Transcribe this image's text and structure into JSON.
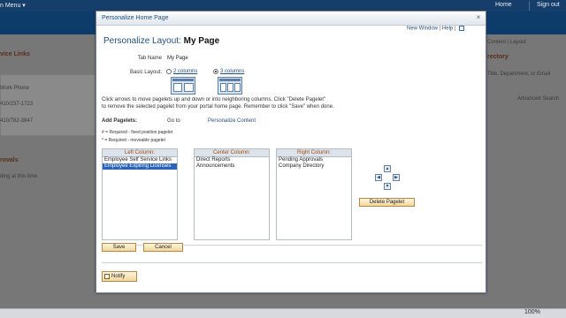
{
  "bg": {
    "menu": "n Menu ▾",
    "home": "Home",
    "signout": "Sign out",
    "left_title": "vice Links",
    "left_hdr": "Work Phone",
    "left_ph1": "410/237-1723",
    "left_ph2": "410/782-3847",
    "left2_title": "rovals",
    "left2_text": "ding at this time.",
    "right_links": "Content | Layout",
    "right_title": "rectory",
    "right_text": "Title, Department, or Email",
    "right_adv": "Advanced Search",
    "zoom": "100%"
  },
  "modal": {
    "title": "Personalize Home Page",
    "close": "×",
    "links": {
      "new_window": "New Window",
      "sep": " | ",
      "help": "Help",
      "sep2": " | "
    },
    "heading_prefix": "Personalize Layout: ",
    "heading_name": "My Page",
    "tab_name_label": "Tab Name",
    "tab_name_value": "My Page",
    "basic_layout_label": "Basic Layout:",
    "option_2": "2 columns",
    "option_3": "3 columns",
    "selected_layout": "3 columns",
    "instructions1": "Click arrows to move pagelets up and down or into neighboring columns. Click \"Delete Pagelet\"",
    "instructions2": "to remove the selected pagelet from your portal home page. Remember to click \"Save\" when done.",
    "add_pagelets": "Add Pagelets:",
    "go_to": "Go to",
    "personalize_content": "Personalize Content",
    "legend1": "# = Required - fixed position pagelet",
    "legend2": "* = Required - moveable pagelet",
    "columns": {
      "left": {
        "header": "Left Column:",
        "items": [
          "Employee Self Service Links",
          "Employee Expiring Licenses"
        ],
        "selected": "Employee Expiring Licenses"
      },
      "center": {
        "header": "Center Column:",
        "items": [
          "Direct Reports",
          "Announcements"
        ]
      },
      "right": {
        "header": "Right Column:",
        "items": [
          "Pending Approvals",
          "Company Directory"
        ]
      }
    },
    "delete_pagelet": "Delete Pagelet",
    "save": "Save",
    "cancel": "Cancel",
    "notify": "Notify"
  }
}
